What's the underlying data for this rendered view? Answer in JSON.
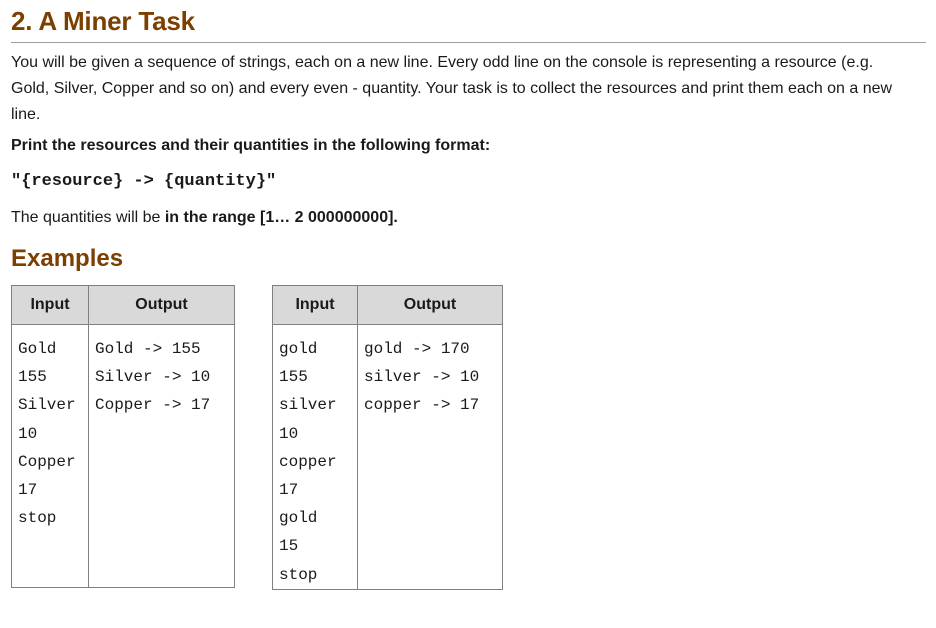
{
  "title": "2. A Miner Task",
  "description": "You will be given a sequence of strings, each on a new line. Every odd line on the console is representing a resource (e.g. Gold, Silver, Copper and so on) and every even - quantity. Your task is to collect the resources and print them each on a new line.",
  "format_heading": "Print the resources and their quantities in the following format:",
  "format_line": "\"{resource} -> {quantity}\"",
  "range_text": "The quantities will be ",
  "range_bold": "in the range [1… 2 000000000].",
  "examples_title": "Examples",
  "examples": [
    {
      "input_header": "Input",
      "output_header": "Output",
      "input": [
        "Gold",
        "155",
        "Silver",
        "10",
        "Copper",
        "17",
        "stop"
      ],
      "output": [
        "Gold -> 155",
        "Silver -> 10",
        "Copper -> 17"
      ]
    },
    {
      "input_header": "Input",
      "output_header": "Output",
      "input": [
        "gold",
        "155",
        "silver",
        "10",
        "copper",
        "17",
        "gold",
        "15",
        "stop"
      ],
      "output": [
        "gold -> 170",
        "silver -> 10",
        "copper -> 17"
      ]
    }
  ]
}
